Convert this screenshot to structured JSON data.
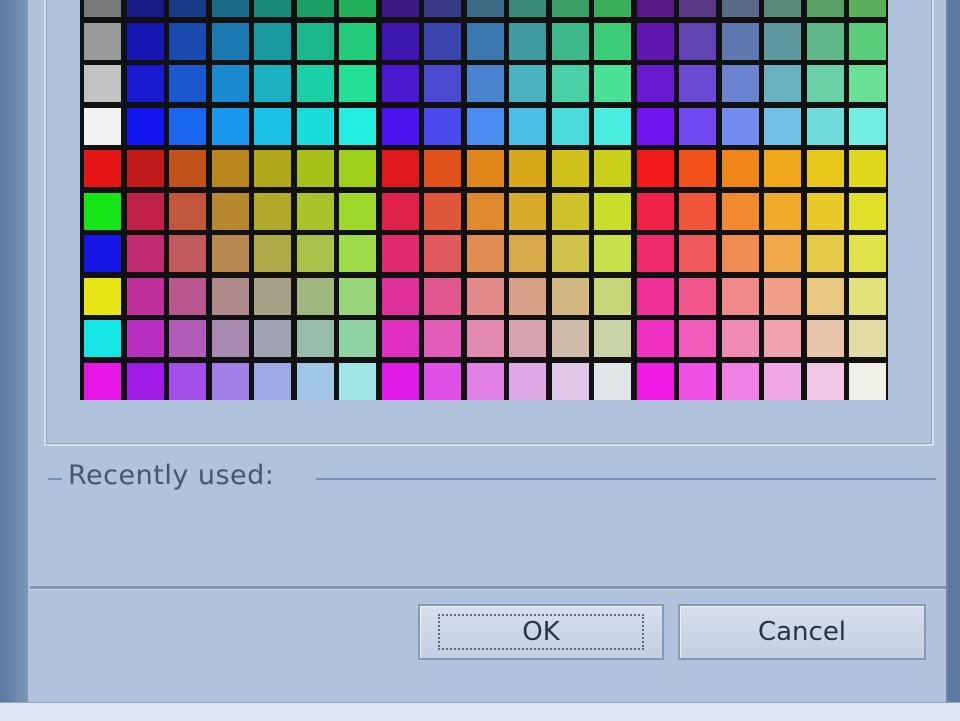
{
  "recently_used": {
    "label": "Recently used:"
  },
  "buttons": {
    "ok": "OK",
    "cancel": "Cancel"
  },
  "palette": {
    "rows": [
      [
        "#7a7a7a",
        "#1a1a86",
        "#1a3c86",
        "#1a6a86",
        "#1a8a7a",
        "#1aa066",
        "#22b05a",
        "#3a1a86",
        "#3a3a86",
        "#3a6a86",
        "#3a8a7a",
        "#3aa066",
        "#3ab05a",
        "#5a1a86",
        "#5a3a86",
        "#5a6a86",
        "#5a8a7a",
        "#5aa066",
        "#5ab05a"
      ],
      [
        "#9a9a9a",
        "#1616b0",
        "#1a4cb0",
        "#1a7ab0",
        "#1a9aa0",
        "#1ab88a",
        "#22cc7a",
        "#3c16b0",
        "#3c44b0",
        "#3c78b0",
        "#3c9aa0",
        "#3cb88a",
        "#3ccc7a",
        "#6016b0",
        "#6044b0",
        "#6078b0",
        "#6098a0",
        "#60b88a",
        "#5acc7a"
      ],
      [
        "#c2c2c2",
        "#1a1ad0",
        "#1a58d0",
        "#1a8ad0",
        "#1ab2c0",
        "#1ad0a6",
        "#22e096",
        "#4a1ad0",
        "#4a4ad0",
        "#4a84d0",
        "#4ab2c0",
        "#4ad0a6",
        "#4ae096",
        "#6a1ad0",
        "#6a4ad0",
        "#6a84d0",
        "#6ab2c0",
        "#6ad0a6",
        "#6ae096"
      ],
      [
        "#f2f2f2",
        "#1414f0",
        "#1a66f0",
        "#1a98f0",
        "#1ac0e6",
        "#1adcdc",
        "#22eee0",
        "#4a14f0",
        "#4a4af0",
        "#4a8cf0",
        "#4ac0e6",
        "#4adcdc",
        "#4aeee0",
        "#7014f0",
        "#704af0",
        "#708cf0",
        "#70c0e6",
        "#70dcdc",
        "#70eee0"
      ],
      [
        "#e61616",
        "#c01a1a",
        "#c0521a",
        "#b8861a",
        "#b0a81a",
        "#a8c01a",
        "#9ed01a",
        "#e01a1a",
        "#e0521a",
        "#e0861a",
        "#d8a81a",
        "#d0c01a",
        "#c8d01a",
        "#f01a1a",
        "#f0521a",
        "#f0861a",
        "#f0a81a",
        "#e8c81a",
        "#e0d81a"
      ],
      [
        "#16e616",
        "#c0224a",
        "#c0563a",
        "#b8882e",
        "#b0aa2a",
        "#a8c22a",
        "#9ed82a",
        "#e0224a",
        "#e0563a",
        "#e08a2e",
        "#d8aa2a",
        "#d0c22a",
        "#c8dc2a",
        "#f0224a",
        "#f0563a",
        "#f08a2e",
        "#f0aa2a",
        "#e8ca2a",
        "#e0e02a"
      ],
      [
        "#1616e6",
        "#c02a6e",
        "#c05a5e",
        "#b88a52",
        "#b0aa4a",
        "#a8c24a",
        "#9edc4a",
        "#e02a6e",
        "#e05a5e",
        "#e08c52",
        "#d8aa4a",
        "#d0c44a",
        "#c8e04a",
        "#f02a6e",
        "#f05a5e",
        "#f08c52",
        "#f0aa4a",
        "#e8ca4a",
        "#e0e44a"
      ],
      [
        "#e6e616",
        "#c0309a",
        "#b8588e",
        "#b08a8a",
        "#a8a086",
        "#a0b880",
        "#98d47a",
        "#e0309a",
        "#e0588e",
        "#e08a8a",
        "#d8a086",
        "#d0b880",
        "#c8d67a",
        "#f0309a",
        "#f0588e",
        "#f08a8a",
        "#f0a086",
        "#e8c880",
        "#e0e27a"
      ],
      [
        "#16e6e6",
        "#b830c0",
        "#b05cb8",
        "#a88ab0",
        "#a0a4b0",
        "#98bcaa",
        "#90d4a4",
        "#e030c0",
        "#e05cb8",
        "#e08ab0",
        "#d8a4b0",
        "#d0bcaa",
        "#c8d4a4",
        "#f030c0",
        "#f05cb8",
        "#f08ab0",
        "#f0a4b0",
        "#e8c4aa",
        "#e0dca4"
      ],
      [
        "#e616e6",
        "#a01ae6",
        "#a050e6",
        "#a080e6",
        "#a0a8e6",
        "#a0c8e6",
        "#a0e6e6",
        "#e01ae6",
        "#e050e6",
        "#e080e6",
        "#e0a8e6",
        "#e0c8e6",
        "#e0e6e6",
        "#f01ae6",
        "#f050e6",
        "#f080e6",
        "#f0a8e6",
        "#f0c8e6",
        "#f0f0e6"
      ]
    ]
  }
}
